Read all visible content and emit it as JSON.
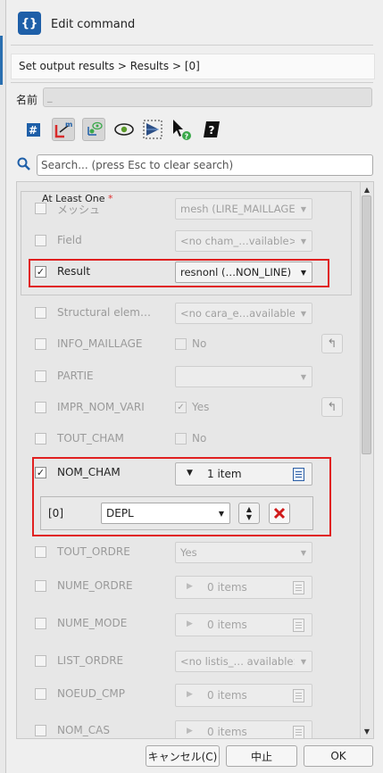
{
  "window": {
    "title": "Edit command",
    "icon": "code-braces-icon"
  },
  "breadcrumb": "Set output results > Results > [0]",
  "name_field": {
    "label": "名前",
    "value": "_"
  },
  "toolbar": {
    "icons": [
      "hash-icon",
      "linkage-icon",
      "graph-icon",
      "eye-icon",
      "mesh-view-icon",
      "pointer-help-icon",
      "doc-help-icon"
    ]
  },
  "search": {
    "placeholder": "Search... (press Esc to clear search)"
  },
  "group": {
    "title": "At Least One",
    "required_mark": "*"
  },
  "rows": {
    "mesh": {
      "label": "メッシュ",
      "value": "mesh (LIRE_MAILLAGE)"
    },
    "field": {
      "label": "Field",
      "value": "<no cham_…vailable>"
    },
    "result": {
      "label": "Result",
      "value": "resnonl (…NON_LINE)",
      "checked": "✓"
    },
    "structural": {
      "label": "Structural elem…",
      "value": "<no cara_e…available>"
    },
    "info_maillage": {
      "label": "INFO_MAILLAGE",
      "value": "No"
    },
    "partie": {
      "label": "PARTIE",
      "value": ""
    },
    "impr_nom_vari": {
      "label": "IMPR_NOM_VARI",
      "value": "Yes",
      "checked": "✓"
    },
    "tout_cham": {
      "label": "TOUT_CHAM",
      "value": "No"
    },
    "nom_cham": {
      "label": "NOM_CHAM",
      "count": "1 item",
      "checked": "✓",
      "item": {
        "index": "[0]",
        "value": "DEPL"
      }
    },
    "tout_ordre": {
      "label": "TOUT_ORDRE",
      "value": "Yes"
    },
    "nume_ordre": {
      "label": "NUME_ORDRE",
      "count": "0 items"
    },
    "nume_mode": {
      "label": "NUME_MODE",
      "count": "0 items"
    },
    "list_ordre": {
      "label": "LIST_ORDRE",
      "value": "<no listis_… available>"
    },
    "noeud_cmp": {
      "label": "NOEUD_CMP",
      "count": "0 items"
    },
    "nom_cas": {
      "label": "NOM_CAS",
      "count": "0 items"
    }
  },
  "buttons": {
    "cancel": "キャンセル(C)",
    "abort": "中止",
    "ok": "OK"
  },
  "colors": {
    "accent": "#1e5fa8",
    "highlight": "#e02020",
    "delete": "#d01a1a"
  }
}
